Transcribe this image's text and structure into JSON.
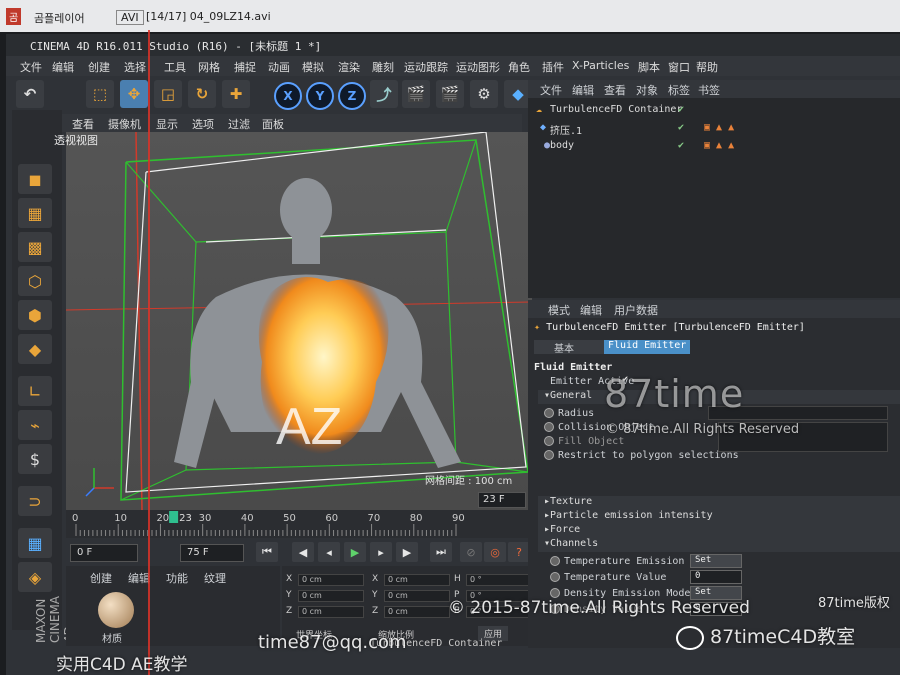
{
  "player": {
    "brand": "곰",
    "app": "곰플레이어",
    "format": "AVI",
    "file": "[14/17] 04_09LZ14.avi"
  },
  "window_title": "CINEMA 4D R16.011 Studio (R16) - [未标题 1 *]",
  "menu": [
    "文件",
    "编辑",
    "创建",
    "选择",
    "工具",
    "网格",
    "捕捉",
    "动画",
    "模拟",
    "渲染",
    "雕刻",
    "运动跟踪",
    "运动图形",
    "角色",
    "插件",
    "X-Particles",
    "脚本",
    "窗口",
    "帮助"
  ],
  "toolbar_axes": [
    "X",
    "Y",
    "Z"
  ],
  "viewport": {
    "menu": [
      "查看",
      "摄像机",
      "显示",
      "选项",
      "过滤",
      "面板"
    ],
    "label": "透视视图",
    "grid_label": "网格间距 : 100 cm",
    "text_on_model": "AZ"
  },
  "timeline": {
    "ticks": [
      "0",
      "10",
      "20",
      "23",
      "30",
      "40",
      "50",
      "60",
      "70",
      "80",
      "90"
    ],
    "current_marker": "23",
    "current_field": "23 F",
    "start_field": "0 F",
    "end_field": "75 F"
  },
  "material_panel": {
    "tabs": [
      "创建",
      "编辑",
      "功能",
      "纹理"
    ],
    "material_name": "材质"
  },
  "coords": {
    "rows": [
      {
        "a": "X",
        "av": "0 cm",
        "b": "X",
        "bv": "0 cm",
        "c": "H",
        "cv": "0 °"
      },
      {
        "a": "Y",
        "av": "0 cm",
        "b": "Y",
        "bv": "0 cm",
        "c": "P",
        "cv": "0 °"
      },
      {
        "a": "Z",
        "av": "0 cm",
        "b": "Z",
        "bv": "0 cm",
        "c": "B",
        "cv": "0 °"
      }
    ],
    "world_label": "世界坐标",
    "scale_label": "缩放比例",
    "apply_label": "应用"
  },
  "object_manager": {
    "menu": [
      "文件",
      "编辑",
      "查看",
      "对象",
      "标签",
      "书签"
    ],
    "objects": [
      {
        "name": "TurbulenceFD Container"
      },
      {
        "name": "挤压.1"
      },
      {
        "name": "body"
      }
    ]
  },
  "attributes": {
    "menu": [
      "模式",
      "编辑",
      "用户数据"
    ],
    "object_title": "TurbulenceFD Emitter [TurbulenceFD Emitter]",
    "tabs": [
      "基本",
      "Fluid Emitter"
    ],
    "section_title": "Fluid Emitter",
    "emitter_active_label": "Emitter Active",
    "general": "General",
    "radius_label": "Radius",
    "collision_label": "Collision Object",
    "fill_label": "Fill Object",
    "restrict_label": "Restrict to polygon selections",
    "collapsed_sections": [
      "Texture",
      "Particle emission intensity",
      "Force"
    ],
    "channels": "Channels",
    "temp_mode_label": "Temperature Emission Mode",
    "temp_mode_value": "Set",
    "temp_value_label": "Temperature Value",
    "temp_value": "0",
    "density_mode_label": "Density Emission Mode",
    "density_mode_value": "Set",
    "density_value_label": "Density Value",
    "density_value": "0",
    "bottom_label": "TurbulenceFD Container"
  },
  "watermarks": {
    "logo": "87time",
    "reserved_small": "© 87time.All Rights Reserved",
    "copyright": "© 2015-87time.All Rights Reserved",
    "email": "time87@qq.com",
    "left_caption": "实用C4D AE教学",
    "wechat": "87timeC4D教室",
    "right_top": "87time版权"
  },
  "maxon_side": "MAXON CINEMA 4D"
}
